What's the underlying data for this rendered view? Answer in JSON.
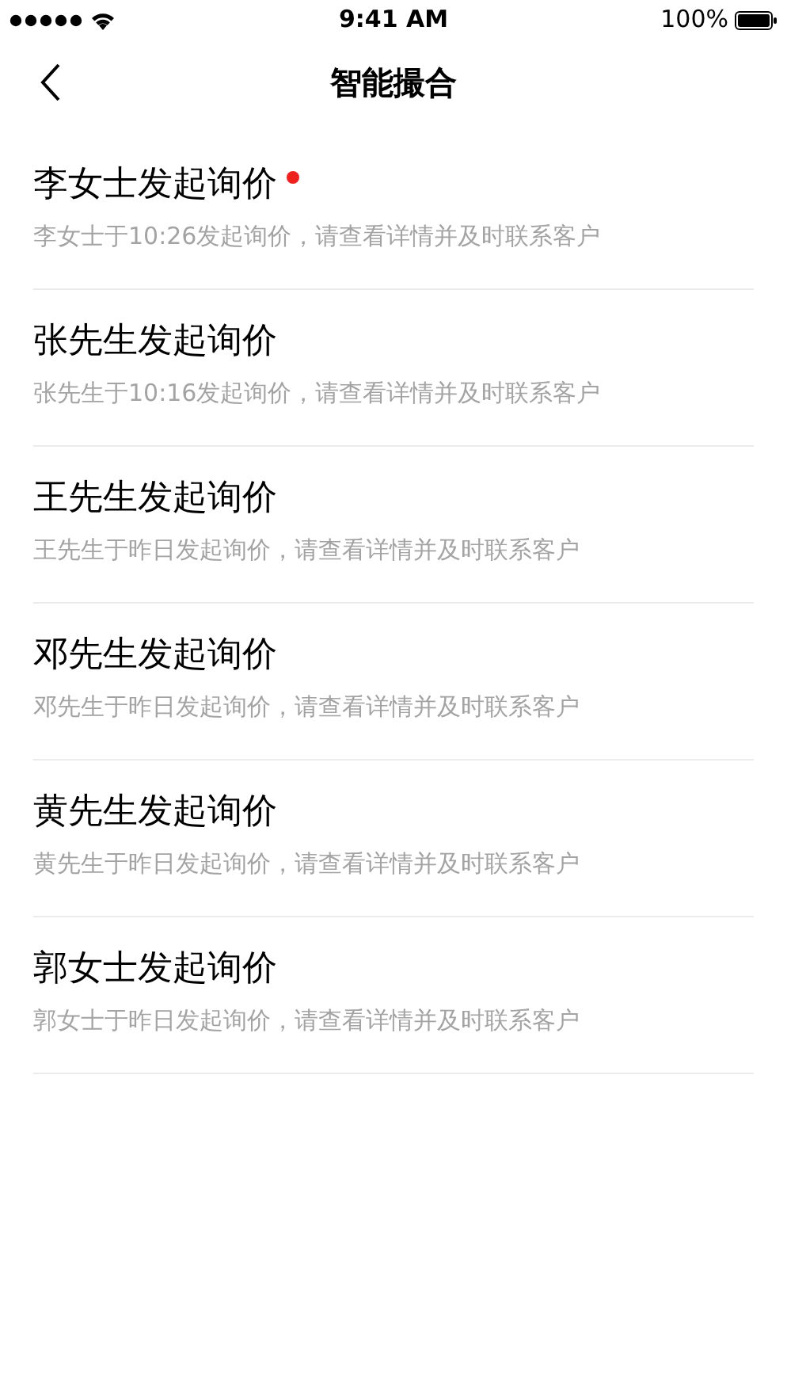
{
  "status_bar": {
    "time": "9:41 AM",
    "battery": "100%"
  },
  "nav": {
    "title": "智能撮合"
  },
  "items": [
    {
      "title": "李女士发起询价",
      "subtitle": "李女士于10:26发起询价，请查看详情并及时联系客户",
      "unread": true
    },
    {
      "title": "张先生发起询价",
      "subtitle": "张先生于10:16发起询价，请查看详情并及时联系客户",
      "unread": false
    },
    {
      "title": "王先生发起询价",
      "subtitle": "王先生于昨日发起询价，请查看详情并及时联系客户",
      "unread": false
    },
    {
      "title": "邓先生发起询价",
      "subtitle": "邓先生于昨日发起询价，请查看详情并及时联系客户",
      "unread": false
    },
    {
      "title": "黄先生发起询价",
      "subtitle": "黄先生于昨日发起询价，请查看详情并及时联系客户",
      "unread": false
    },
    {
      "title": "郭女士发起询价",
      "subtitle": "郭女士于昨日发起询价，请查看详情并及时联系客户",
      "unread": false
    }
  ]
}
